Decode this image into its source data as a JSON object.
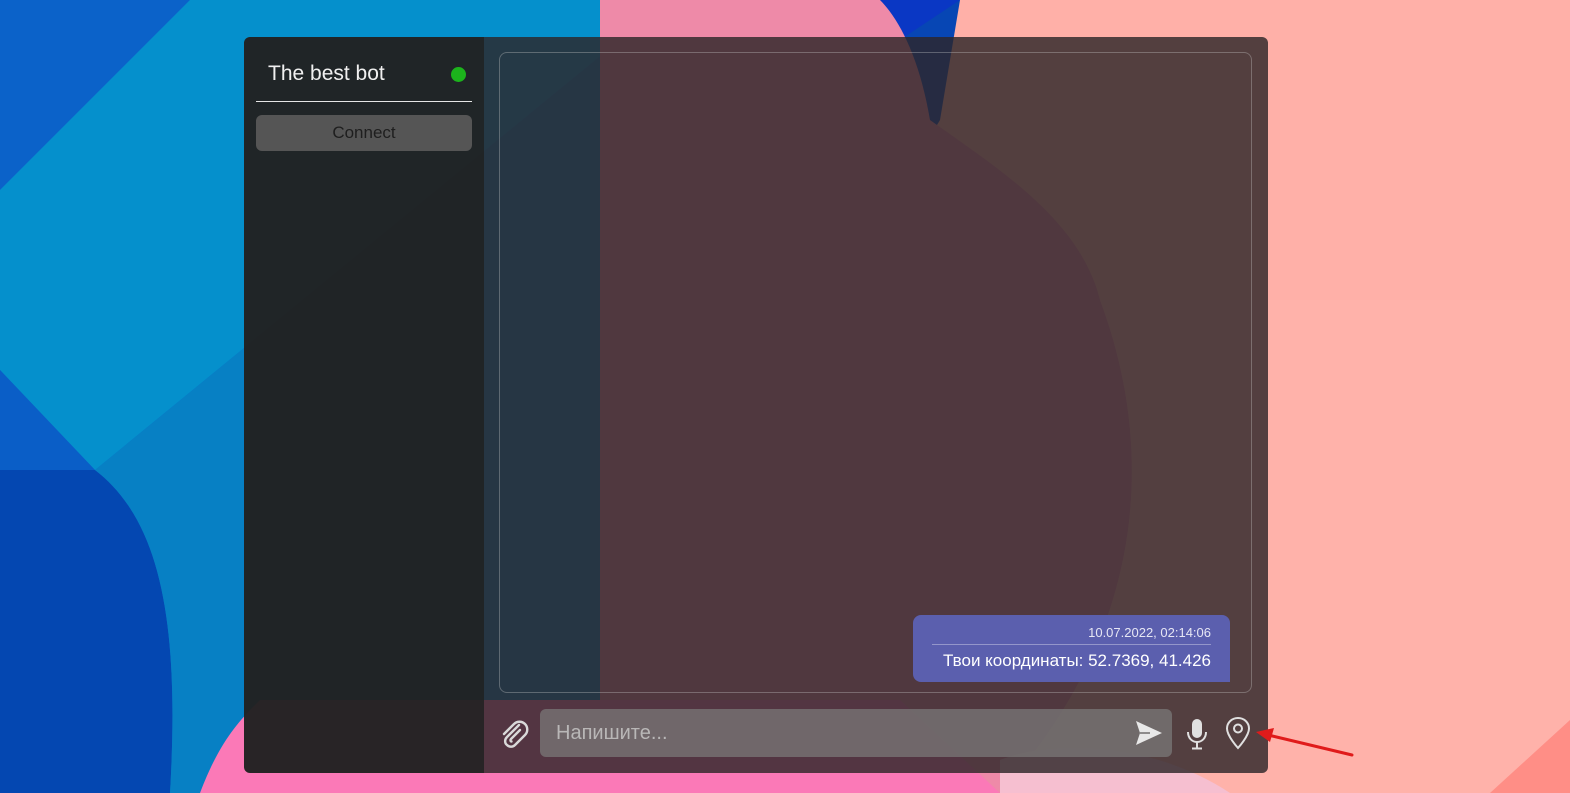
{
  "colors": {
    "status_online": "#1cb31c",
    "bubble_background": "#5b5fae",
    "annotation_arrow": "#e01b1b"
  },
  "sidebar": {
    "bot_name": "The best bot",
    "status_icon": "online-dot-icon",
    "connect_label": "Connect"
  },
  "chat": {
    "messages": [
      {
        "timestamp": "10.07.2022, 02:14:06",
        "text": "Твои координаты: 52.7369, 41.426"
      }
    ]
  },
  "composer": {
    "placeholder": "Напишите...",
    "value": "",
    "icons": {
      "attach": "paperclip-icon",
      "send": "send-icon",
      "voice": "microphone-icon",
      "location": "map-pin-icon"
    }
  }
}
